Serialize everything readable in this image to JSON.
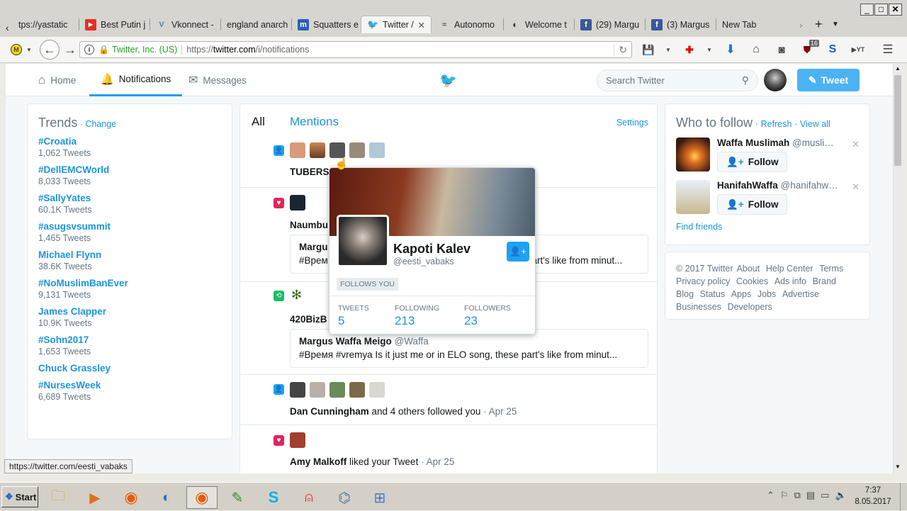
{
  "browser": {
    "tabs": [
      {
        "label": "tps://yastatic",
        "icon": "",
        "color": "#d7d5d0"
      },
      {
        "label": "Best Putin j",
        "icon": "▶",
        "color": "#e52d27"
      },
      {
        "label": "Vkonnect -",
        "icon": "V",
        "color": "#5b7fa6"
      },
      {
        "label": "england anarch",
        "icon": "",
        "color": "#d7d5d0"
      },
      {
        "label": "Squatters e",
        "icon": "m",
        "color": "#2b5eb7"
      },
      {
        "label": "Twitter /",
        "icon": "🐦",
        "color": "#1da1f2"
      },
      {
        "label": "Autonomo",
        "icon": "~",
        "color": "#555"
      },
      {
        "label": "Welcome t",
        "icon": "◐",
        "color": "#333"
      },
      {
        "label": "(29) Margu",
        "icon": "f",
        "color": "#3b5998"
      },
      {
        "label": "(3) Margus",
        "icon": "f",
        "color": "#3b5998"
      },
      {
        "label": "New Tab",
        "icon": "",
        "color": "#d7d5d0"
      }
    ],
    "identity_label": "Twitter, Inc. (US)",
    "url_prefix": "https://",
    "url_domain": "twitter.com",
    "url_path": "/i/notifications",
    "addon_badge": "16",
    "status_url": "https://twitter.com/eesti_vabaks"
  },
  "twitter": {
    "nav": {
      "home": "Home",
      "notifications": "Notifications",
      "messages": "Messages"
    },
    "search_placeholder": "Search Twitter",
    "tweet_button": "Tweet",
    "trends": {
      "title": "Trends",
      "change": "Change",
      "items": [
        {
          "name": "#Croatia",
          "count": "1,062 Tweets"
        },
        {
          "name": "#DellEMCWorld",
          "count": "8,033 Tweets"
        },
        {
          "name": "#SallyYates",
          "count": "60.1K Tweets"
        },
        {
          "name": "#asugsvsummit",
          "count": "1,465 Tweets"
        },
        {
          "name": "Michael Flynn",
          "count": "38.6K Tweets"
        },
        {
          "name": "#NoMuslimBanEver",
          "count": "9,131 Tweets"
        },
        {
          "name": "James Clapper",
          "count": "10.9K Tweets"
        },
        {
          "name": "#Sohn2017",
          "count": "1,653 Tweets"
        },
        {
          "name": "Chuck Grassley",
          "count": ""
        },
        {
          "name": "#NursesWeek",
          "count": "6,689 Tweets"
        }
      ]
    },
    "notifications": {
      "tab_all": "All",
      "tab_mentions": "Mentions",
      "settings": "Settings",
      "n1_name": "TUBERS",
      "n2_name": "Naumbu",
      "n2_quote_name": "Margu",
      "n2_quote_text": "#Врем",
      "n2_quote_tail": "part's like from minut...",
      "n3_name": "420BizB",
      "n3_quote_name": "Margus Waffa Meigo",
      "n3_quote_handle": "@Waffa",
      "n3_quote_text": "#Время #vremya Is it just me or in ELO song, these part's like from minut...",
      "n4_name": "Dan Cunningham",
      "n4_rest": " and 4 others followed you",
      "n4_time": "Apr 25",
      "n5_name": "Amy Malkoff",
      "n5_rest": " liked your Tweet",
      "n5_time": "Apr 25"
    },
    "hovercard": {
      "name": "Kapoti Kalev",
      "handle": "@eesti_vabaks",
      "follows_you": "FOLLOWS YOU",
      "stats": [
        {
          "label": "TWEETS",
          "value": "5"
        },
        {
          "label": "FOLLOWING",
          "value": "213"
        },
        {
          "label": "FOLLOWERS",
          "value": "23"
        }
      ]
    },
    "who_to_follow": {
      "title": "Who to follow",
      "refresh": "Refresh",
      "view_all": "View all",
      "users": [
        {
          "name": "Waffa Muslimah",
          "handle": "@musli…",
          "follow": "Follow"
        },
        {
          "name": "HanifahWaffa",
          "handle": "@hanifahw…",
          "follow": "Follow"
        }
      ],
      "find_friends": "Find friends"
    },
    "footer": {
      "copyright": "© 2017 Twitter",
      "links": [
        "About",
        "Help Center",
        "Terms",
        "Privacy policy",
        "Cookies",
        "Ads info",
        "Brand",
        "Blog",
        "Status",
        "Apps",
        "Jobs",
        "Advertise",
        "Businesses",
        "Developers"
      ]
    }
  },
  "taskbar": {
    "start": "Start",
    "time": "7:37",
    "date": "8.05.2017"
  }
}
